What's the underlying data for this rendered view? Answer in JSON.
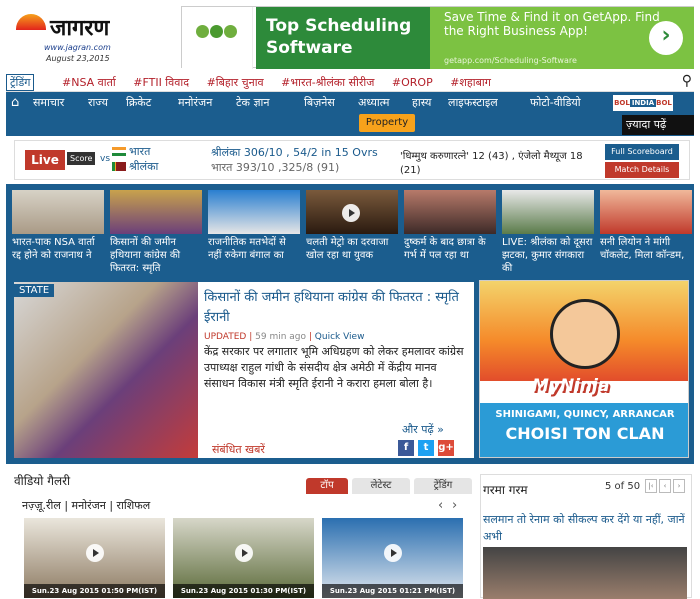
{
  "header": {
    "brand": "जागरण",
    "url": "www.jagran.com",
    "date": "August 23,2015"
  },
  "ad_top": {
    "headline": "Top Scheduling Software",
    "tagline": "Save Time & Find it on GetApp. Find the Right Business App!",
    "source_url": "getapp.com/Scheduling-Software",
    "arrow_icon": "chevron-right-icon"
  },
  "trending": {
    "label": "ट्रेंडिंग",
    "items": [
      "#NSA वार्ता",
      "#FTII विवाद",
      "#बिहार चुनाव",
      "#भारत-श्रीलंका सीरीज",
      "#OROP",
      "#शहाबाग"
    ],
    "search_icon": "search-icon"
  },
  "nav": {
    "home_icon": "home-icon",
    "items": [
      "समाचार",
      "राज्य",
      "क्रिकेट",
      "मनोरंजन",
      "टेक ज्ञान",
      "बिज़नेस",
      "अध्यात्म",
      "हास्य",
      "लाइफस्टाइल",
      "फोटो-वीडियो"
    ],
    "bol_left": "BOL",
    "bol_mid": "INDIA",
    "bol_right": "BOL",
    "property": "Property",
    "more": "ज़्यादा पढ़ें"
  },
  "score": {
    "live": "Live",
    "score_label": "Score",
    "vs": "vs",
    "team1": "भारत",
    "team2": "श्रीलंका",
    "line1": "श्रीलंका 306/10 , 54/2 in 15 Ovrs",
    "line2": "भारत 393/10 ,325/8 (91)",
    "commentary": "'धिम्मुथ करुणारत्ने' 12 (43) , एंजेलो मैथ्यूज 18 (21)",
    "full_scoreboard": "Full Scoreboard",
    "match_details": "Match Details",
    "colors": {
      "live": "#c0392b",
      "nav": "#1b5d8e"
    }
  },
  "photo_strip": [
    {
      "caption": "भारत-पाक NSA वार्ता रद्द होने को राजनाथ ने",
      "video": false
    },
    {
      "caption": "किसानों की जमीन हथियाना कांग्रेस की फितरत: स्मृति",
      "video": false
    },
    {
      "caption": "राजनीतिक मतभेदों से नहीं रुकेगा बंगाल का",
      "video": false
    },
    {
      "caption": "चलती मेट्रो का दरवाजा खोल रहा था युवक",
      "video": true
    },
    {
      "caption": "दुष्कर्म के बाद छात्रा के गर्भ में पल रहा था",
      "video": false
    },
    {
      "caption": "LIVE: श्रीलंका को दूसरा झटका, कुमार संगकारा की",
      "video": false
    },
    {
      "caption": "सनी लियोन ने मांगी चॉकलेट, मिला कॉन्डम,",
      "video": false
    }
  ],
  "feature": {
    "state_badge": "STATE",
    "headline": "किसानों की जमीन हथियाना कांग्रेस की फितरत : स्मृति ईरानी",
    "updated": "UPDATED",
    "time_ago": "59 min ago",
    "quick_view": "Quick View",
    "body": "केंद्र सरकार पर लगातार भूमि अधिग्रहण को लेकर हमलावर कांग्रेस उपाध्यक्ष राहुल गांधी के संसदीय क्षेत्र अमेठी में केंद्रीय मानव संसाधन विकास मंत्री स्मृति ईरानी ने करारा हमला बोला है।",
    "more": "और पढ़ें »",
    "related": "संबंधित खबरें",
    "share_icons": [
      "facebook-icon",
      "twitter-icon",
      "googleplus-icon"
    ]
  },
  "ad_side": {
    "logo": "MyNinja",
    "sub": "SHINIGAMI, QUINCY, ARRANCAR",
    "cta": "CHOISI TON CLAN"
  },
  "video_gallery": {
    "title": "वीडियो गैलरी",
    "tabs": [
      "टॉप",
      "लेटेस्ट",
      "ट्रेंडिंग"
    ],
    "categories": "नज़्ज़ू.रील | मनोरंजन | राशिफल",
    "cards": [
      {
        "timestamp": "Sun.23 Aug 2015 01:50 PM(IST)"
      },
      {
        "timestamp": "Sun.23 Aug 2015 01:30 PM(IST)"
      },
      {
        "timestamp": "Sun.23 Aug 2015 01:21 PM(IST)"
      }
    ]
  },
  "garma_garam": {
    "title": "गरमा गरम",
    "page": "5 of 50",
    "headline": "सलमान तो रेनाम को सीकल्प कर देंगे या नहीं, जानें अभी"
  }
}
